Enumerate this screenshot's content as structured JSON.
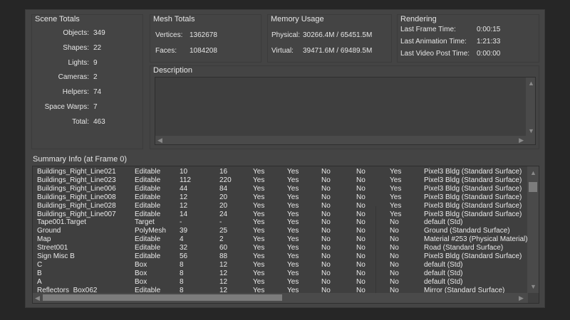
{
  "scene_totals": {
    "title": "Scene Totals",
    "items": [
      {
        "label": "Objects:",
        "value": "349"
      },
      {
        "label": "Shapes:",
        "value": "22"
      },
      {
        "label": "Lights:",
        "value": "9"
      },
      {
        "label": "Cameras:",
        "value": "2"
      },
      {
        "label": "Helpers:",
        "value": "74"
      },
      {
        "label": "Space Warps:",
        "value": "7"
      },
      {
        "label": "Total:",
        "value": "463"
      }
    ]
  },
  "mesh_totals": {
    "title": "Mesh Totals",
    "vertices_label": "Vertices:",
    "vertices_value": "1362678",
    "faces_label": "Faces:",
    "faces_value": "1084208"
  },
  "memory": {
    "title": "Memory Usage",
    "physical_label": "Physical:",
    "physical_value": "30266.4M / 65451.5M",
    "virtual_label": "Virtual:",
    "virtual_value": "39471.6M / 69489.5M"
  },
  "rendering": {
    "title": "Rendering",
    "items": [
      {
        "label": "Last Frame Time:",
        "value": "0:00:15"
      },
      {
        "label": "Last Animation Time:",
        "value": "1:21:33"
      },
      {
        "label": "Last Video Post Time:",
        "value": "0:00:00"
      }
    ]
  },
  "description": {
    "title": "Description",
    "text": ""
  },
  "summary": {
    "title": "Summary Info (at Frame 0)",
    "rows": [
      [
        "Buildings_Right_Line021",
        "Editable",
        "10",
        "16",
        "Yes",
        "Yes",
        "No",
        "No",
        "Yes",
        "Pixel3 Bldg (Standard Surface)"
      ],
      [
        "Buildings_Right_Line023",
        "Editable",
        "112",
        "220",
        "Yes",
        "Yes",
        "No",
        "No",
        "Yes",
        "Pixel3 Bldg (Standard Surface)"
      ],
      [
        "Buildings_Right_Line006",
        "Editable",
        "44",
        "84",
        "Yes",
        "Yes",
        "No",
        "No",
        "Yes",
        "Pixel3 Bldg (Standard Surface)"
      ],
      [
        "Buildings_Right_Line008",
        "Editable",
        "12",
        "20",
        "Yes",
        "Yes",
        "No",
        "No",
        "Yes",
        "Pixel3 Bldg (Standard Surface)"
      ],
      [
        "Buildings_Right_Line028",
        "Editable",
        "12",
        "20",
        "Yes",
        "Yes",
        "No",
        "No",
        "Yes",
        "Pixel3 Bldg (Standard Surface)"
      ],
      [
        "Buildings_Right_Line007",
        "Editable",
        "14",
        "24",
        "Yes",
        "Yes",
        "No",
        "No",
        "Yes",
        "Pixel3 Bldg (Standard Surface)"
      ],
      [
        "Tape001.Target",
        "Target",
        "-",
        "-",
        "Yes",
        "Yes",
        "No",
        "No",
        "No",
        "default (Std)"
      ],
      [
        "Ground",
        "PolyMesh",
        "39",
        "25",
        "Yes",
        "Yes",
        "No",
        "No",
        "No",
        "Ground (Standard Surface)"
      ],
      [
        "Map",
        "Editable",
        "4",
        "2",
        "Yes",
        "Yes",
        "No",
        "No",
        "No",
        "Material #253 (Physical Material)"
      ],
      [
        "Street001",
        "Editable",
        "32",
        "60",
        "Yes",
        "Yes",
        "No",
        "No",
        "No",
        "Road (Standard Surface)"
      ],
      [
        "Sign Misc B",
        "Editable",
        "56",
        "88",
        "Yes",
        "Yes",
        "No",
        "No",
        "No",
        "Pixel3 Bldg (Standard Surface)"
      ],
      [
        "C",
        "Box",
        "8",
        "12",
        "Yes",
        "Yes",
        "No",
        "No",
        "No",
        "default (Std)"
      ],
      [
        "B",
        "Box",
        "8",
        "12",
        "Yes",
        "Yes",
        "No",
        "No",
        "No",
        "default (Std)"
      ],
      [
        "A",
        "Box",
        "8",
        "12",
        "Yes",
        "Yes",
        "No",
        "No",
        "No",
        "default (Std)"
      ],
      [
        "Reflectors_Box062",
        "Editable",
        "8",
        "12",
        "Yes",
        "Yes",
        "No",
        "No",
        "No",
        "Mirror (Standard Surface)"
      ]
    ]
  },
  "icons": {
    "up": "▲",
    "down": "▼",
    "left": "◀",
    "right": "▶"
  }
}
